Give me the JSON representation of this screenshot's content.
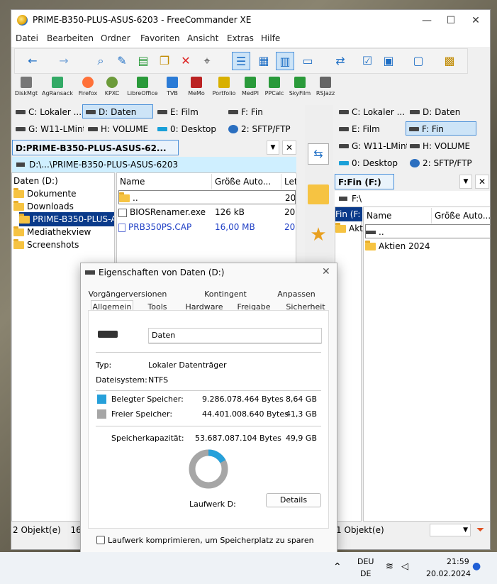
{
  "window": {
    "title": "PRIME-B350-PLUS-ASUS-6203 - FreeCommander XE",
    "minimize": "—",
    "maximize": "☐",
    "close": "✕"
  },
  "menu": [
    "Datei",
    "Bearbeiten",
    "Ordner",
    "Favoriten",
    "Ansicht",
    "Extras",
    "Hilfe"
  ],
  "tools": [
    "DiskMgt",
    "AgRansack",
    "Firefox",
    "KPXC",
    "LibreOffice",
    "TVB",
    "MeMo",
    "Portfolio",
    "MedPl",
    "PPCalc",
    "SkyFilm",
    "RSJazz"
  ],
  "left": {
    "drives_row1": [
      "C: Lokaler ...",
      "D: Daten",
      "E: Film",
      "F: Fin"
    ],
    "drives_row2": [
      "G: W11-LMint",
      "H: VOLUME",
      "0: Desktop",
      "2: SFTP/FTP"
    ],
    "tab": "D:PRIME-B350-PLUS-ASUS-62...",
    "path": "D:\\...\\PRIME-B350-PLUS-ASUS-6203",
    "tree": [
      "Daten (D:)",
      "Dokumente",
      "Downloads",
      "PRIME-B350-PLUS-A",
      "Mediathekview",
      "Screenshots"
    ],
    "cols": [
      "Name",
      "Größe Auto...",
      "Let"
    ],
    "files": [
      {
        "name": "..",
        "size": "",
        "date": "20."
      },
      {
        "name": "BIOSRenamer.exe",
        "size": "126 kB",
        "date": "20."
      },
      {
        "name": "PRB350PS.CAP",
        "size": "16,00 MB",
        "date": "20."
      }
    ],
    "status": "2 Objekt(e)",
    "status2": "16,"
  },
  "right": {
    "drives_row1": [
      "C: Lokaler ...",
      "D: Daten"
    ],
    "drives_row2": [
      "E: Film",
      "F: Fin"
    ],
    "drives_row3": [
      "G: W11-LMint",
      "H: VOLUME"
    ],
    "drives_row4": [
      "0: Desktop",
      "2: SFTP/FTP"
    ],
    "tab": "F:Fin (F:)",
    "path": "F:\\",
    "tree": [
      "Fin (F:",
      "Akti"
    ],
    "cols": [
      "Name",
      "Größe Auto..."
    ],
    "files": [
      {
        "name": ".."
      },
      {
        "name": "Aktien 2024"
      }
    ],
    "status": "1 Objekt(e)"
  },
  "dialog": {
    "title": "Eigenschaften von Daten (D:)",
    "tabs_top": [
      "Vorgängerversionen",
      "Kontingent",
      "Anpassen"
    ],
    "tabs_bottom": [
      "Allgemein",
      "Tools",
      "Hardware",
      "Freigabe",
      "Sicherheit"
    ],
    "name_value": "Daten",
    "typ_label": "Typ:",
    "typ_value": "Lokaler Datenträger",
    "fs_label": "Dateisystem:",
    "fs_value": "NTFS",
    "used_label": "Belegter Speicher:",
    "used_bytes": "9.286.078.464 Bytes",
    "used_gb": "8,64 GB",
    "free_label": "Freier Speicher:",
    "free_bytes": "44.401.008.640 Bytes",
    "free_gb": "41,3 GB",
    "cap_label": "Speicherkapazität:",
    "cap_bytes": "53.687.087.104 Bytes",
    "cap_gb": "49,9 GB",
    "used_fraction": 0.173,
    "drive_label": "Laufwerk D:",
    "details_button": "Details",
    "compress_label": "Laufwerk komprimieren, um Speicherplatz zu sparen",
    "used_color": "#26a0da",
    "free_color": "#a6a6a6"
  },
  "taskbar": {
    "lang1": "DEU",
    "lang2": "DE",
    "time": "21:59",
    "date": "20.02.2024"
  }
}
